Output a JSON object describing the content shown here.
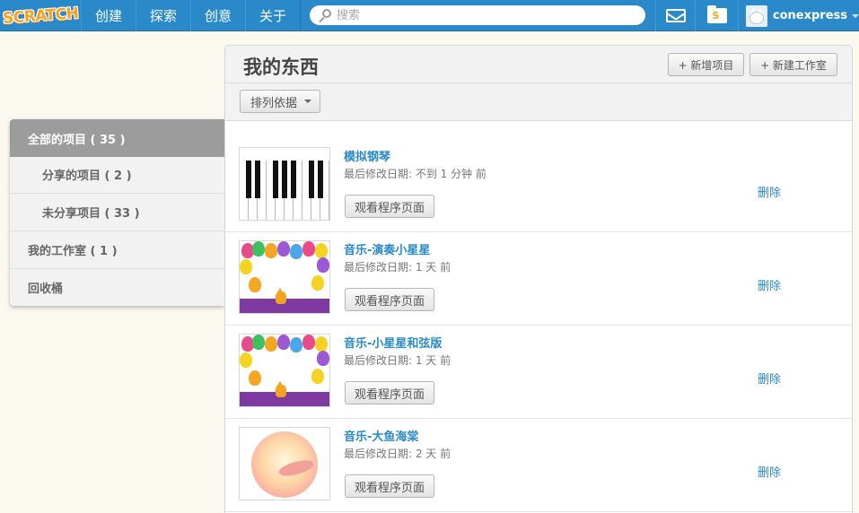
{
  "header": {
    "logo_text": "SCRATCH",
    "nav": [
      "创建",
      "探索",
      "创意",
      "关于"
    ],
    "search_placeholder": "搜索",
    "folder_glyph": "S",
    "username": "conexpress"
  },
  "sidebar": {
    "items": [
      {
        "label": "全部的项目 ( 35 )",
        "active": true
      },
      {
        "label": "分享的项目 ( 2 )"
      },
      {
        "label": "未分享项目 ( 33 )"
      },
      {
        "label": "我的工作室 ( 1 )"
      },
      {
        "label": "回收桶"
      }
    ]
  },
  "main": {
    "title": "我的东西",
    "new_project_label": "+ 新增项目",
    "new_studio_label": "+ 新建工作室",
    "sort_label": "排列依据",
    "projects": [
      {
        "title": "模拟钢琴",
        "date": "最后修改日期:  不到 1 分钟 前",
        "view_label": "观看程序页面",
        "delete_label": "删除",
        "thumb": "piano"
      },
      {
        "title": "音乐-演奏小星星",
        "date": "最后修改日期:  1 天 前",
        "view_label": "观看程序页面",
        "delete_label": "删除",
        "thumb": "balloons"
      },
      {
        "title": "音乐-小星星和弦版",
        "date": "最后修改日期:  1 天 前",
        "view_label": "观看程序页面",
        "delete_label": "删除",
        "thumb": "balloons"
      },
      {
        "title": "音乐-大鱼海棠",
        "date": "最后修改日期:  2 天 前",
        "view_label": "观看程序页面",
        "delete_label": "删除",
        "thumb": "fish"
      }
    ]
  },
  "colors": {
    "topbar": "#2a8ac9",
    "link": "#2a8ac9",
    "sidebar_active": "#9c9c9c",
    "background": "#fbf8ef"
  },
  "icons": [
    "search-icon",
    "mail-icon",
    "folder-icon",
    "avatar",
    "caret-down-icon"
  ]
}
